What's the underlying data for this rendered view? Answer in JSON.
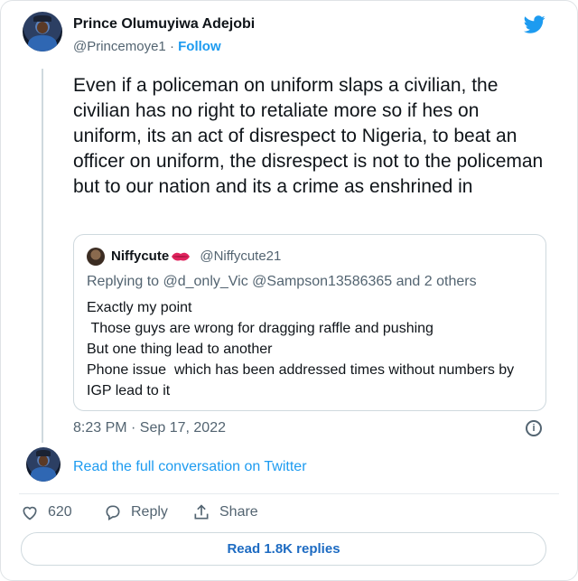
{
  "author": {
    "name": "Prince Olumuyiwa Adejobi",
    "handle": "@Princemoye1",
    "separator": "·",
    "follow_label": "Follow"
  },
  "tweet": {
    "text": "Even if a policeman on uniform slaps a civilian, the civilian has no right to retaliate more so if hes on uniform, its an act of disrespect to Nigeria, to beat an officer on uniform,  the disrespect is not to the policeman but to our nation  and its a crime as enshrined in",
    "timestamp": "8:23 PM · Sep 17, 2022"
  },
  "quoted_tweet": {
    "name": "Niffycute",
    "handle": "@Niffycute21",
    "replying_to": "Replying to @d_only_Vic @Sampson13586365 and 2 others",
    "text": "Exactly my point\n Those guys are wrong for dragging raffle and pushing\nBut one thing lead to another\nPhone issue  which has been addressed times without numbers by IGP lead to it"
  },
  "conversation_link": "Read the full conversation on Twitter",
  "actions": {
    "like_count": "620",
    "reply_label": "Reply",
    "share_label": "Share"
  },
  "read_replies_label": "Read 1.8K replies",
  "icons": [
    "twitter-bird-icon",
    "lips-emoji-icon",
    "info-icon",
    "heart-icon",
    "reply-bubble-icon",
    "share-icon"
  ],
  "colors": {
    "accent": "#1d9bf0",
    "text": "#0f1419",
    "muted": "#536471"
  }
}
